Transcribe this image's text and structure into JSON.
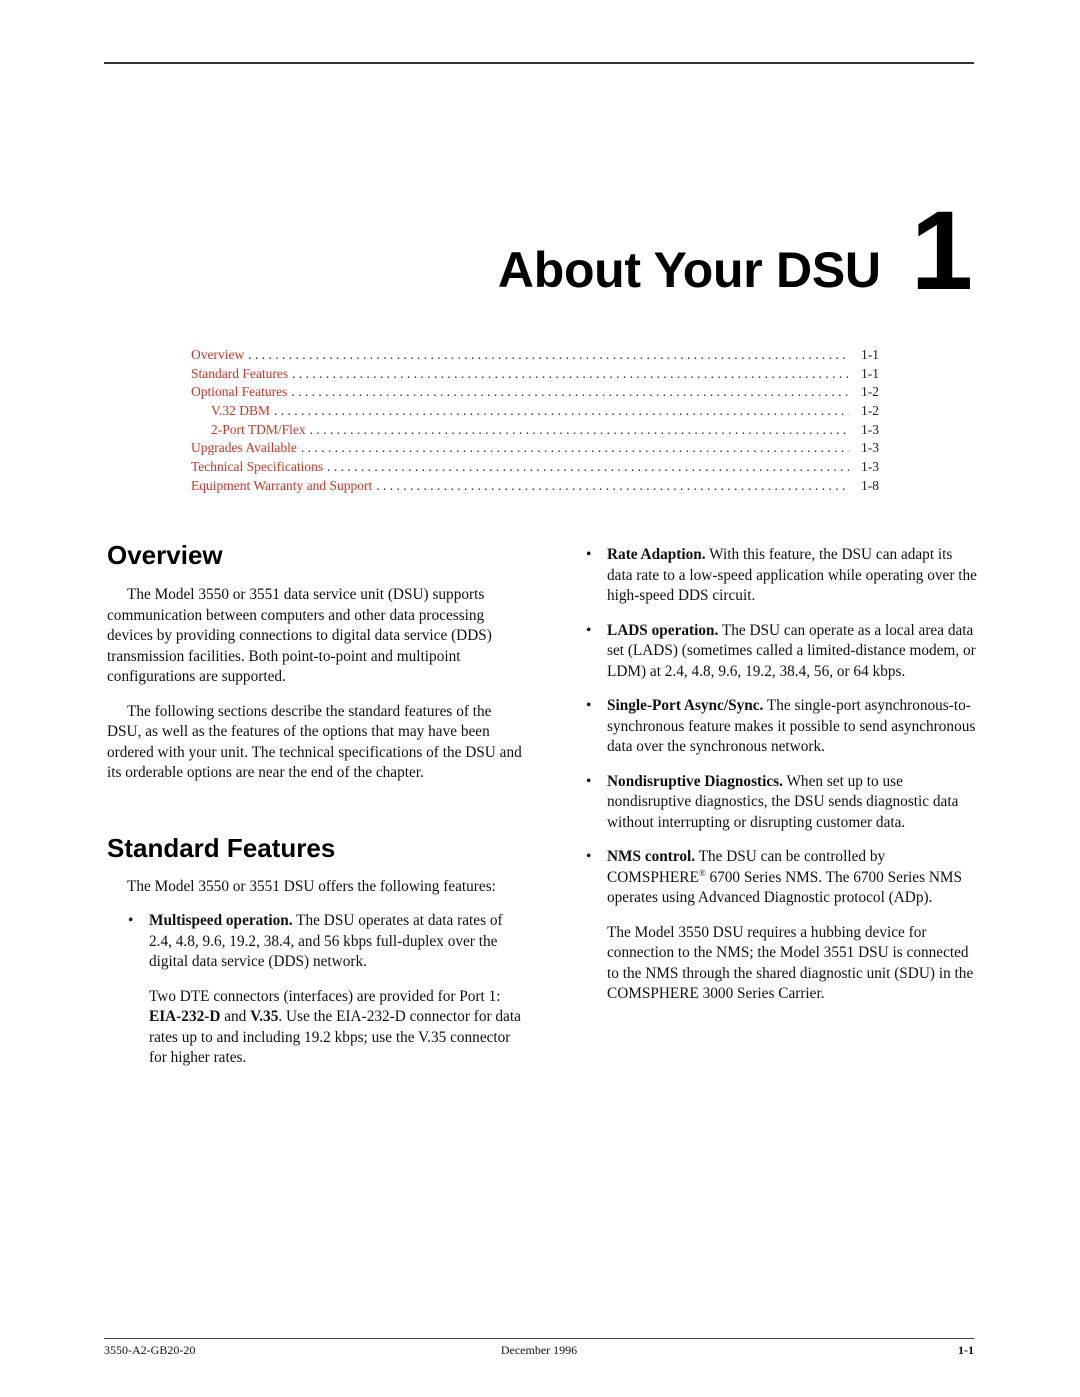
{
  "chapter": {
    "title": "About Your DSU",
    "number": "1"
  },
  "toc": [
    {
      "label": "Overview",
      "page": "1-1",
      "level": 1
    },
    {
      "label": "Standard Features",
      "page": "1-1",
      "level": 1
    },
    {
      "label": "Optional Features",
      "page": "1-2",
      "level": 1
    },
    {
      "label": "V.32 DBM",
      "page": "1-2",
      "level": 2
    },
    {
      "label": "2-Port TDM/Flex",
      "page": "1-3",
      "level": 2
    },
    {
      "label": "Upgrades Available",
      "page": "1-3",
      "level": 1
    },
    {
      "label": "Technical Specifications",
      "page": "1-3",
      "level": 1
    },
    {
      "label": "Equipment Warranty and Support",
      "page": "1-8",
      "level": 1
    }
  ],
  "toc_link_color": "#c0392b",
  "overview": {
    "heading": "Overview",
    "paragraphs": [
      "The Model 3550 or 3551 data service unit (DSU) supports communication between computers and other data processing devices by providing connections to digital data service (DDS) transmission facilities. Both point-to-point and multipoint configurations are supported.",
      "The following sections describe the standard features of the DSU, as well as the features of the options that may have been ordered with your unit. The technical specifications of the DSU and its orderable options are near the end of the chapter."
    ]
  },
  "standard_features": {
    "heading": "Standard Features",
    "intro": "The Model 3550 or 3551 DSU offers the following features:",
    "bullet_char": "•",
    "items": [
      {
        "term": "Multispeed operation.",
        "text": " The DSU operates at data rates of 2.4, 4.8, 9.6, 19.2, 38.4, and 56 kbps full-duplex over the digital data service (DDS) network.",
        "extra": {
          "t1": "Two DTE connectors (interfaces) are provided for Port 1: ",
          "b1": "EIA-232-D",
          "t2": " and ",
          "b2": "V.35",
          "t3": ". Use the EIA-232-D connector for data rates up to and including 19.2 kbps; use the V.35 connector for higher rates."
        }
      },
      {
        "term": "Rate Adaption.",
        "text": " With this feature, the DSU can adapt its data rate to a low-speed application while operating over the high-speed DDS circuit."
      },
      {
        "term": "LADS operation.",
        "text": " The DSU can operate as a local area data set (LADS) (sometimes called a limited-distance modem, or LDM) at 2.4, 4.8, 9.6, 19.2, 38.4, 56, or 64 kbps."
      },
      {
        "term": "Single-Port Async/Sync.",
        "text": " The single-port asynchronous-to-synchronous feature makes it possible to send asynchronous data over the synchronous network."
      },
      {
        "term": "Nondisruptive Diagnostics.",
        "text": " When set up to use nondisruptive diagnostics, the DSU sends diagnostic data without interrupting or disrupting customer data."
      },
      {
        "term": "NMS control.",
        "text_a": " The DSU can be controlled by COMSPHERE",
        "reg": "®",
        "text_b": " 6700 Series NMS. The 6700 Series NMS operates using Advanced Diagnostic protocol (ADp).",
        "extra": "The Model 3550 DSU requires a hubbing device for connection to the NMS; the Model 3551 DSU is connected to the NMS through the shared diagnostic unit (SDU) in the COMSPHERE 3000 Series Carrier."
      }
    ]
  },
  "footer": {
    "doc_number": "3550-A2-GB20-20",
    "date": "December 1996",
    "page": "1-1"
  }
}
